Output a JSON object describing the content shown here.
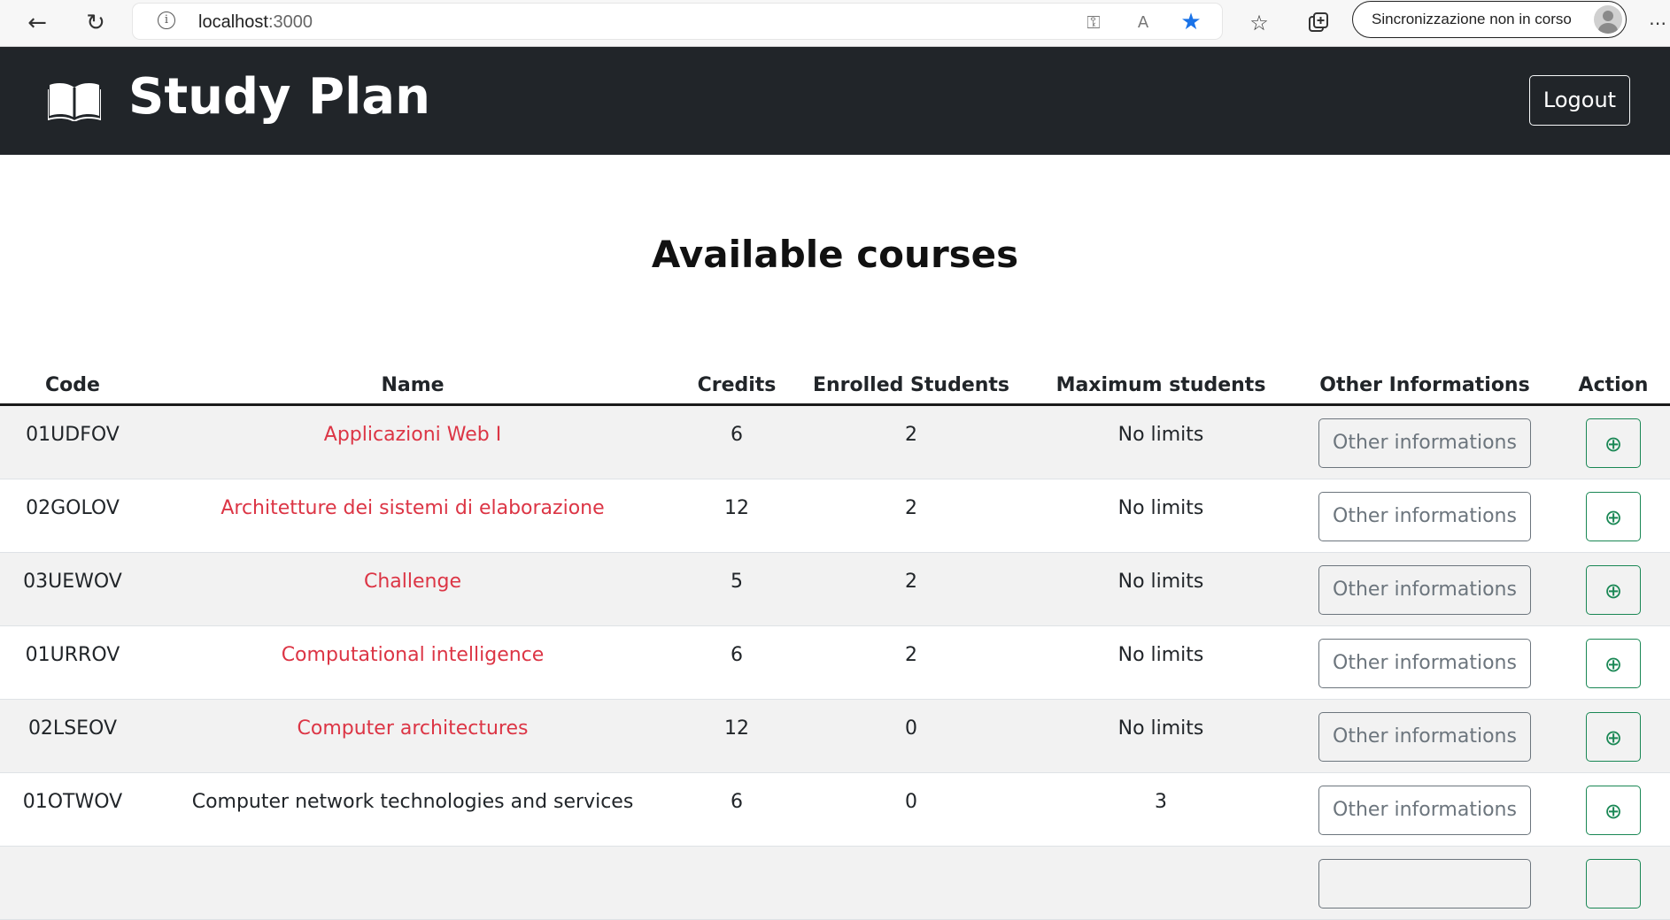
{
  "browser": {
    "url_host": "localhost",
    "url_port": ":3000",
    "sync_text": "Sincronizzazione non in corso"
  },
  "navbar": {
    "brand": "Study Plan",
    "logout_label": "Logout"
  },
  "page": {
    "title": "Available courses"
  },
  "table": {
    "headers": {
      "code": "Code",
      "name": "Name",
      "credits": "Credits",
      "enrolled": "Enrolled Students",
      "max": "Maximum students",
      "other": "Other Informations",
      "action": "Action"
    },
    "other_button_label": "Other informations",
    "add_button_glyph": "⊕",
    "rows": [
      {
        "code": "01UDFOV",
        "name": "Applicazioni Web I",
        "credits": "6",
        "enrolled": "2",
        "max": "No limits"
      },
      {
        "code": "02GOLOV",
        "name": "Architetture dei sistemi di elaborazione",
        "credits": "12",
        "enrolled": "2",
        "max": "No limits"
      },
      {
        "code": "03UEWOV",
        "name": "Challenge",
        "credits": "5",
        "enrolled": "2",
        "max": "No limits"
      },
      {
        "code": "01URROV",
        "name": "Computational intelligence",
        "credits": "6",
        "enrolled": "2",
        "max": "No limits"
      },
      {
        "code": "02LSEOV",
        "name": "Computer architectures",
        "credits": "12",
        "enrolled": "0",
        "max": "No limits"
      },
      {
        "code": "01OTWOV",
        "name": "Computer network technologies and services",
        "credits": "6",
        "enrolled": "0",
        "max": "3"
      }
    ]
  },
  "colors": {
    "navbar_bg": "#212529",
    "course_name_red": "#dc3545",
    "add_green": "#198754",
    "other_gray": "#6c757d"
  }
}
